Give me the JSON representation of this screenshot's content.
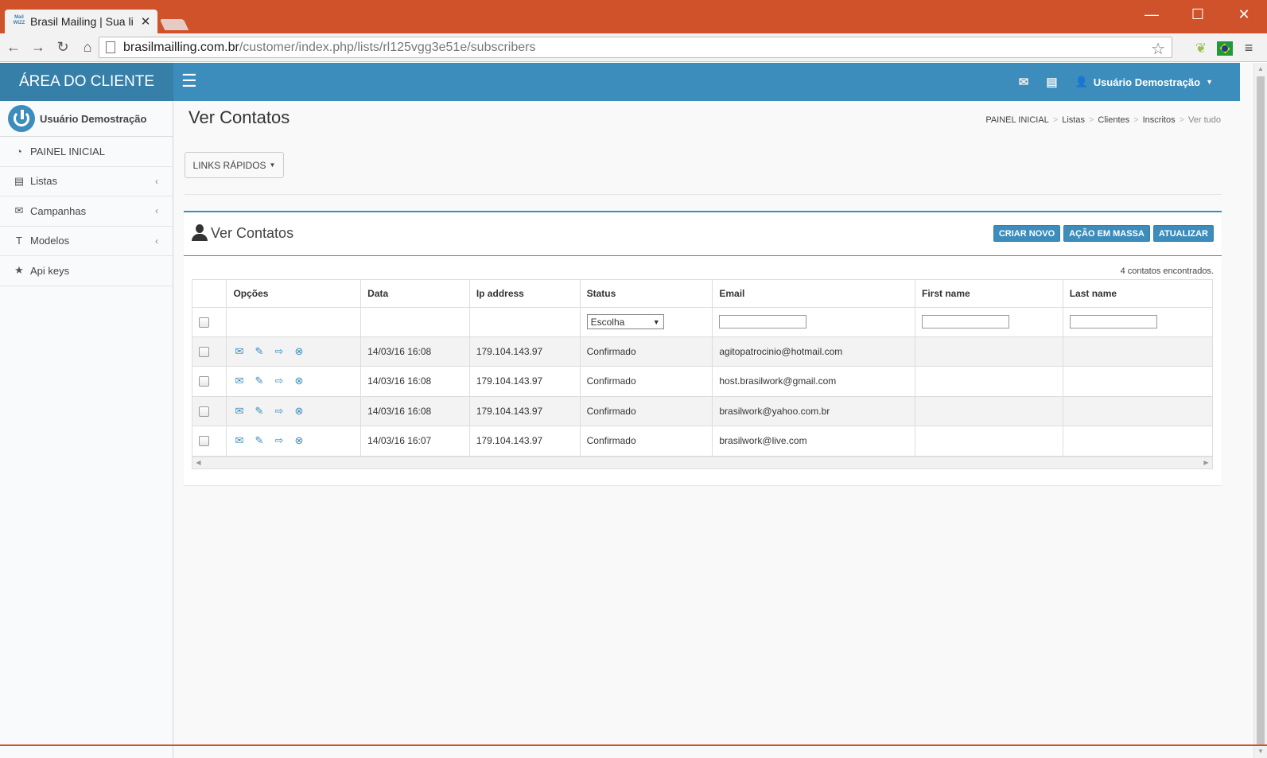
{
  "browser": {
    "tab_favicon": "Mail WIZZ",
    "tab_title": "Brasil Mailing | Sua li",
    "url_host": "brasilmailling.com.br",
    "url_path": "/customer/index.php/lists/rl125vgg3e51e/subscribers",
    "accent_color": "#cf522b"
  },
  "topnav": {
    "logo": "ÁREA DO CLIENTE",
    "user": "Usuário Demostração",
    "brand_color": "#3c8dbc"
  },
  "sidebar": {
    "user_name": "Usuário Demostração",
    "items": [
      {
        "label": "PAINEL INICIAL",
        "icon": "dashboard-icon"
      },
      {
        "label": "Listas",
        "icon": "list-icon"
      },
      {
        "label": "Campanhas",
        "icon": "envelope-icon"
      },
      {
        "label": "Modelos",
        "icon": "text-icon"
      },
      {
        "label": "Api keys",
        "icon": "star-icon"
      }
    ]
  },
  "header": {
    "title": "Ver Contatos",
    "breadcrumb": [
      "PAINEL INICIAL",
      "Listas",
      "Clientes",
      "Inscritos",
      "Ver tudo"
    ],
    "quick_links": "LINKS RÁPIDOS"
  },
  "box": {
    "title": "Ver Contatos",
    "buttons": {
      "create": "CRIAR NOVO",
      "bulk": "AÇÃO EM MASSA",
      "refresh": "ATUALIZAR"
    },
    "count_text": "4 contatos encontrados."
  },
  "table": {
    "columns": [
      "Opções",
      "Data",
      "Ip address",
      "Status",
      "Email",
      "First name",
      "Last name"
    ],
    "status_filter": "Escolha",
    "rows": [
      {
        "date": "14/03/16 16:08",
        "ip": "179.104.143.97",
        "status": "Confirmado",
        "email": "agitopatrocinio@hotmail.com",
        "first": "",
        "last": ""
      },
      {
        "date": "14/03/16 16:08",
        "ip": "179.104.143.97",
        "status": "Confirmado",
        "email": "host.brasilwork@gmail.com",
        "first": "",
        "last": ""
      },
      {
        "date": "14/03/16 16:08",
        "ip": "179.104.143.97",
        "status": "Confirmado",
        "email": "brasilwork@yahoo.com.br",
        "first": "",
        "last": ""
      },
      {
        "date": "14/03/16 16:07",
        "ip": "179.104.143.97",
        "status": "Confirmado",
        "email": "brasilwork@live.com",
        "first": "",
        "last": ""
      }
    ]
  }
}
